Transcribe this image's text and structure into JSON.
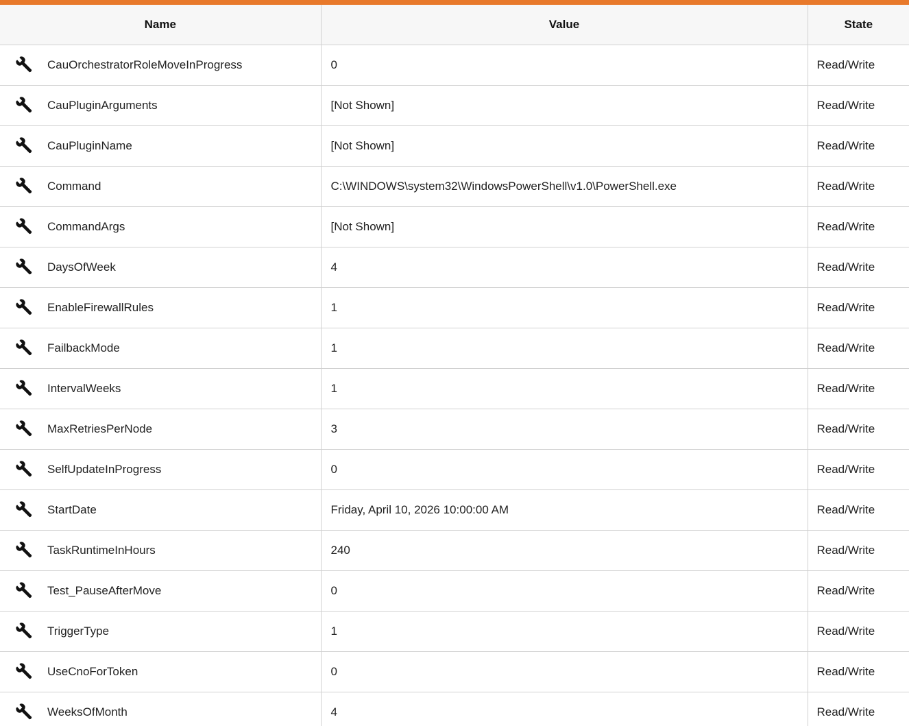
{
  "columns": {
    "name": "Name",
    "value": "Value",
    "state": "State"
  },
  "rows": [
    {
      "name": "CauOrchestratorRoleMoveInProgress",
      "value": "0",
      "state": "Read/Write",
      "icon": "wrench-icon"
    },
    {
      "name": "CauPluginArguments",
      "value": "[Not Shown]",
      "state": "Read/Write",
      "icon": "wrench-icon"
    },
    {
      "name": "CauPluginName",
      "value": "[Not Shown]",
      "state": "Read/Write",
      "icon": "wrench-icon"
    },
    {
      "name": "Command",
      "value": "C:\\WINDOWS\\system32\\WindowsPowerShell\\v1.0\\PowerShell.exe",
      "state": "Read/Write",
      "icon": "wrench-icon"
    },
    {
      "name": "CommandArgs",
      "value": "[Not Shown]",
      "state": "Read/Write",
      "icon": "wrench-icon"
    },
    {
      "name": "DaysOfWeek",
      "value": "4",
      "state": "Read/Write",
      "icon": "wrench-icon"
    },
    {
      "name": "EnableFirewallRules",
      "value": "1",
      "state": "Read/Write",
      "icon": "wrench-icon"
    },
    {
      "name": "FailbackMode",
      "value": "1",
      "state": "Read/Write",
      "icon": "wrench-icon"
    },
    {
      "name": "IntervalWeeks",
      "value": "1",
      "state": "Read/Write",
      "icon": "wrench-icon"
    },
    {
      "name": "MaxRetriesPerNode",
      "value": "3",
      "state": "Read/Write",
      "icon": "wrench-icon"
    },
    {
      "name": "SelfUpdateInProgress",
      "value": "0",
      "state": "Read/Write",
      "icon": "wrench-icon"
    },
    {
      "name": "StartDate",
      "value": "Friday, April 10, 2026 10:00:00 AM",
      "state": "Read/Write",
      "icon": "wrench-icon"
    },
    {
      "name": "TaskRuntimeInHours",
      "value": "240",
      "state": "Read/Write",
      "icon": "wrench-icon"
    },
    {
      "name": "Test_PauseAfterMove",
      "value": "0",
      "state": "Read/Write",
      "icon": "wrench-icon"
    },
    {
      "name": "TriggerType",
      "value": "1",
      "state": "Read/Write",
      "icon": "wrench-icon"
    },
    {
      "name": "UseCnoForToken",
      "value": "0",
      "state": "Read/Write",
      "icon": "wrench-icon"
    },
    {
      "name": "WeeksOfMonth",
      "value": "4",
      "state": "Read/Write",
      "icon": "wrench-icon"
    }
  ],
  "colors": {
    "accent": "#e8792b",
    "header_bg": "#f7f7f7",
    "border": "#d0d0d0"
  }
}
